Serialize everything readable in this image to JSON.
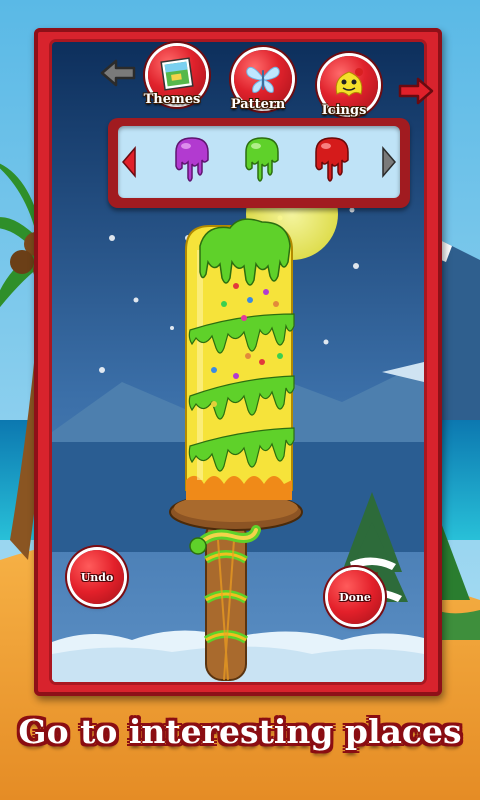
{
  "toolbar": {
    "back_icon": "back-arrow-icon",
    "forward_icon": "forward-arrow-icon",
    "buttons": [
      {
        "label": "Themes",
        "icon": "themes-icon"
      },
      {
        "label": "Pattern",
        "icon": "butterfly-icon"
      },
      {
        "label": "Icings",
        "icon": "icing-character-icon"
      }
    ]
  },
  "palette": {
    "left_icon": "palette-left-arrow-icon",
    "right_icon": "palette-right-arrow-icon",
    "swatches": [
      {
        "name": "purple-icing",
        "color": "#b23ad0"
      },
      {
        "name": "green-icing",
        "color": "#5fd12a"
      },
      {
        "name": "red-icing",
        "color": "#d51b1b"
      }
    ]
  },
  "actions": {
    "undo_label": "Undo",
    "done_label": "Done"
  },
  "popsicle": {
    "body_color": "#f6e33a",
    "icing_color": "#5fd12a",
    "stick_color": "#9a6228"
  },
  "banner": {
    "text": "Go to interesting places"
  },
  "colors": {
    "frame": "#d8232d",
    "sky": "#6fc3e8",
    "sand": "#f2a53a",
    "sea": "#1aa3c8"
  }
}
